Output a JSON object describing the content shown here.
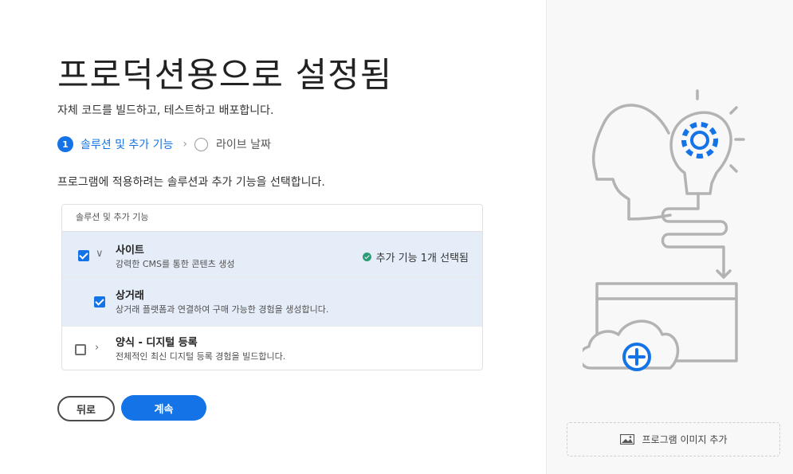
{
  "page": {
    "title": "프로덕션용으로 설정됨",
    "subtitle": "자체 코드를 빌드하고, 테스트하고 배포합니다."
  },
  "steps": [
    {
      "number": "1",
      "label": "솔루션 및 추가 기능",
      "state": "active"
    },
    {
      "label": "라이브 날짜",
      "state": "pending"
    }
  ],
  "instruction": "프로그램에 적용하려는 솔루션과 추가 기능을 선택합니다.",
  "table": {
    "header": "솔루션 및 추가 기능",
    "rows": [
      {
        "title": "사이트",
        "description": "강력한 CMS를 통한 콘텐츠 생성",
        "checked": true,
        "expanded": true,
        "status": "추가 기능 1개 선택됨"
      },
      {
        "title": "상거래",
        "description": "상거래 플랫폼과 연결하여 구매 가능한 경험을 생성합니다.",
        "checked": true
      },
      {
        "title": "양식 - 디지털 등록",
        "description": "전체적인 최신 디지털 등록 경험을 빌드합니다.",
        "checked": false,
        "expanded": false
      }
    ]
  },
  "buttons": {
    "back": "뒤로",
    "continue": "계속"
  },
  "sidebar": {
    "add_image": "프로그램 이미지 추가",
    "illustration": "head-lightbulb-gear-cloud-illustration"
  },
  "colors": {
    "accent": "#1473e6",
    "success": "#2d9d78",
    "selected_row": "#e5eef8",
    "illustration_stroke": "#b3b3b3"
  },
  "icons": {
    "check": "checkmark-icon",
    "chevron_right": "chevron-right-icon",
    "chevron_down": "chevron-down-icon",
    "image": "image-icon",
    "gear": "gear-icon",
    "plus": "plus-circle-icon"
  }
}
